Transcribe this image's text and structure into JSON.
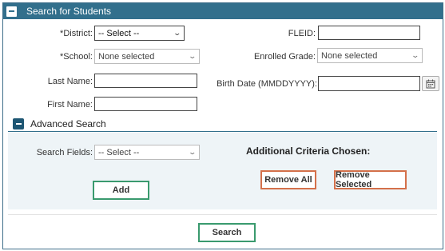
{
  "panel": {
    "title": "Search for Students"
  },
  "fields": {
    "district_label": "*District:",
    "district_value": "-- Select --",
    "fleid_label": "FLEID:",
    "fleid_value": "",
    "school_label": "*School:",
    "school_value": "None selected",
    "grade_label": "Enrolled Grade:",
    "grade_value": "None selected",
    "lastname_label": "Last Name:",
    "lastname_value": "",
    "birthdate_label": "Birth Date (MMDDYYYY):",
    "birthdate_value": "",
    "firstname_label": "First Name:",
    "firstname_value": ""
  },
  "advanced": {
    "title": "Advanced Search",
    "search_fields_label": "Search Fields:",
    "search_fields_value": "-- Select --",
    "criteria_label": "Additional Criteria Chosen:",
    "add_label": "Add",
    "remove_all_label": "Remove All",
    "remove_selected_label": "Remove Selected"
  },
  "actions": {
    "search_label": "Search"
  },
  "icons": {
    "collapse": "minus-icon",
    "calendar": "calendar-icon",
    "dropdown": "chevron-down-icon"
  },
  "colors": {
    "header": "#326f8c",
    "green_button": "#3a9a6e",
    "orange_button": "#d4704a"
  }
}
